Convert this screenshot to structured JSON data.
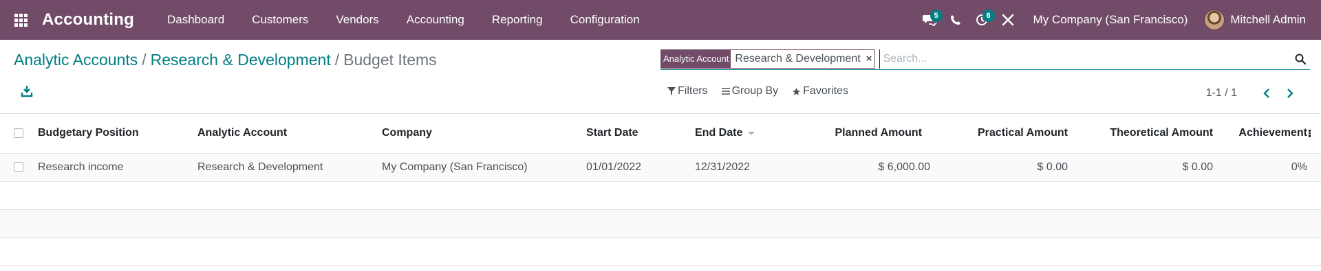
{
  "navbar": {
    "brand": "Accounting",
    "menu": [
      "Dashboard",
      "Customers",
      "Vendors",
      "Accounting",
      "Reporting",
      "Configuration"
    ],
    "messages_count": "5",
    "activities_count": "6",
    "company": "My Company (San Francisco)",
    "user": "Mitchell Admin"
  },
  "breadcrumb": {
    "items": [
      "Analytic Accounts",
      "Research & Development"
    ],
    "separator": "/",
    "current": "Budget Items"
  },
  "search": {
    "facet_label": "Analytic Account",
    "facet_value": "Research & Development",
    "facet_remove": "×",
    "placeholder": "Search..."
  },
  "filters": {
    "filters_label": "Filters",
    "group_by_label": "Group By",
    "favorites_label": "Favorites"
  },
  "pager": {
    "value": "1-1 / 1"
  },
  "table": {
    "columns": [
      "Budgetary Position",
      "Analytic Account",
      "Company",
      "Start Date",
      "End Date",
      "Planned Amount",
      "Practical Amount",
      "Theoretical Amount",
      "Achievement"
    ],
    "rows": [
      {
        "budgetary_position": "Research income",
        "analytic_account": "Research & Development",
        "company": "My Company (San Francisco)",
        "start_date": "01/01/2022",
        "end_date": "12/31/2022",
        "planned_amount": "$ 6,000.00",
        "practical_amount": "$ 0.00",
        "theoretical_amount": "$ 0.00",
        "achievement": "0%"
      }
    ]
  },
  "colors": {
    "navbar": "#714B67",
    "link": "#017E84",
    "badge": "#017E84"
  },
  "icons": [
    "apps-grid-icon",
    "chat-icon",
    "phone-icon",
    "clock-icon",
    "tools-icon",
    "search-icon",
    "download-icon",
    "filter-icon",
    "group-by-icon",
    "star-icon",
    "chevron-left-icon",
    "chevron-right-icon",
    "sort-caret-icon",
    "optional-columns-icon"
  ]
}
